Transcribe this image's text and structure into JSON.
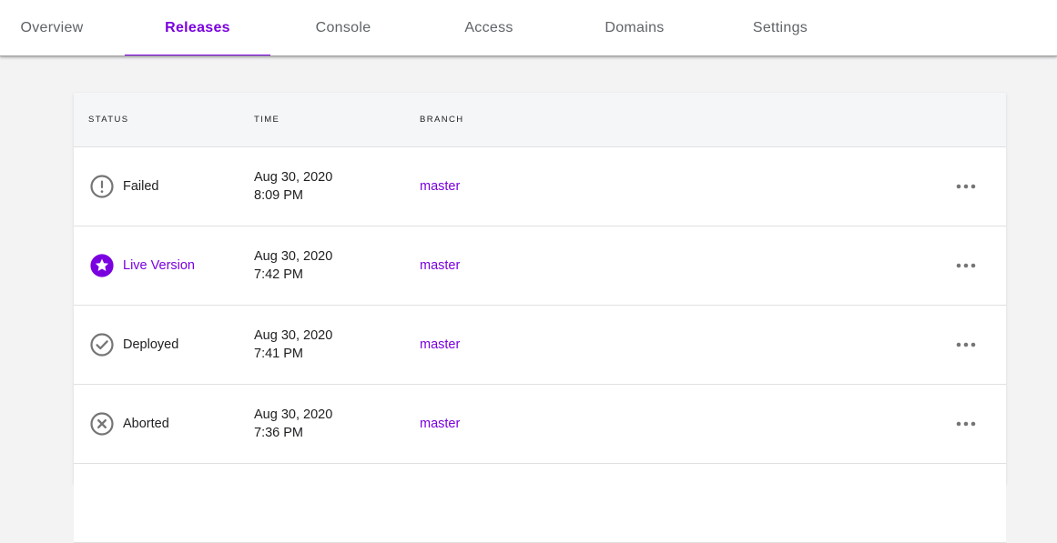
{
  "tabs": [
    {
      "label": "Overview",
      "active": false
    },
    {
      "label": "Releases",
      "active": true
    },
    {
      "label": "Console",
      "active": false
    },
    {
      "label": "Access",
      "active": false
    },
    {
      "label": "Domains",
      "active": false
    },
    {
      "label": "Settings",
      "active": false
    }
  ],
  "colors": {
    "accent": "#7a00e0",
    "icon_gray": "#757575",
    "text": "#202124"
  },
  "table": {
    "headers": {
      "status": "STATUS",
      "time": "TIME",
      "branch": "BRANCH"
    },
    "rows": [
      {
        "status": "Failed",
        "status_icon": "alert-circle-icon",
        "date": "Aug 30, 2020",
        "time": "8:09 PM",
        "branch": "master"
      },
      {
        "status": "Live Version",
        "status_icon": "star-circle-icon",
        "date": "Aug 30, 2020",
        "time": "7:42 PM",
        "branch": "master"
      },
      {
        "status": "Deployed",
        "status_icon": "check-circle-icon",
        "date": "Aug 30, 2020",
        "time": "7:41 PM",
        "branch": "master"
      },
      {
        "status": "Aborted",
        "status_icon": "x-circle-icon",
        "date": "Aug 30, 2020",
        "time": "7:36 PM",
        "branch": "master"
      }
    ]
  }
}
